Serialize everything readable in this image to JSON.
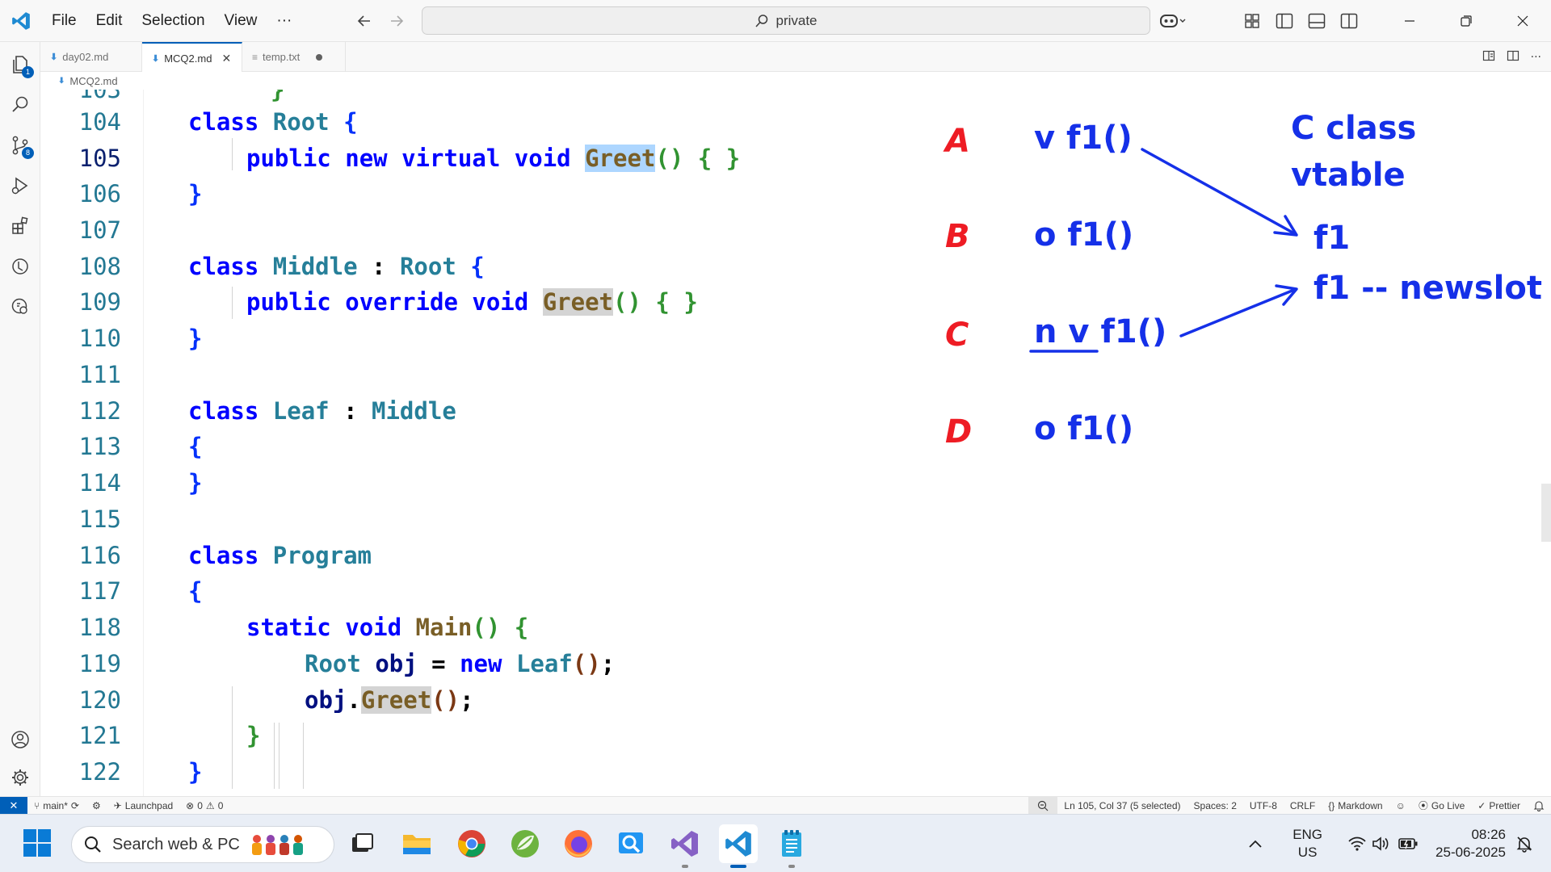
{
  "menu": [
    "File",
    "Edit",
    "Selection",
    "View",
    "···"
  ],
  "command_center": {
    "text": "private"
  },
  "tabs": [
    {
      "label": "day02.md"
    },
    {
      "label": "MCQ2.md",
      "close": "✕"
    },
    {
      "label": "temp.txt"
    }
  ],
  "activity": {
    "explorer_badge": "1",
    "scm_badge": "8"
  },
  "breadcrumb": {
    "file": "MCQ2.md"
  },
  "editor": {
    "partial_line_number": "103",
    "partial_line_text": "}",
    "lines": [
      {
        "n": "104"
      },
      {
        "n": "105"
      },
      {
        "n": "106"
      },
      {
        "n": "107"
      },
      {
        "n": "108"
      },
      {
        "n": "109"
      },
      {
        "n": "110"
      },
      {
        "n": "111"
      },
      {
        "n": "112"
      },
      {
        "n": "113"
      },
      {
        "n": "114"
      },
      {
        "n": "115"
      },
      {
        "n": "116"
      },
      {
        "n": "117"
      },
      {
        "n": "118"
      },
      {
        "n": "119"
      },
      {
        "n": "120"
      },
      {
        "n": "121"
      },
      {
        "n": "122"
      }
    ],
    "code": {
      "kw_class": "class",
      "kw_public": "public",
      "kw_new": "new",
      "kw_virtual": "virtual",
      "kw_void": "void",
      "kw_override": "override",
      "kw_static": "static",
      "type_root": "Root",
      "type_middle": "Middle",
      "type_leaf": "Leaf",
      "type_program": "Program",
      "fn_greet": "Greet",
      "fn_main": "Main",
      "var_obj": "obj",
      "colon": " : ",
      "lbrace": "{",
      "rbrace": "}",
      "parens": "()",
      "lparen": "(",
      "rparen": ")",
      "empty_body": "{ }",
      "assign": " = ",
      "semicolon": ";",
      "dot": "."
    }
  },
  "annotations": {
    "labels": [
      "A",
      "B",
      "C",
      "D"
    ],
    "row_a": "v f1()",
    "row_b": "o f1()",
    "row_c_n": "n",
    "row_c_v": "v",
    "row_c_fn": "f1()",
    "row_d": "o f1()",
    "vtable_title_1": "C class",
    "vtable_title_2": "vtable",
    "vtable_slot_1": "f1",
    "vtable_slot_2": "f1 -- newslot",
    "ink_red": "#ee1c24",
    "ink_blue": "#1530e8"
  },
  "statusbar": {
    "remote": "✕",
    "branch": "main*",
    "launchpad": "Launchpad",
    "problems": "0",
    "warnings": "0",
    "position": "Ln 105, Col 37 (5 selected)",
    "spaces": "Spaces: 2",
    "encoding": "UTF-8",
    "eol": "CRLF",
    "language": "Markdown",
    "golive": "Go Live",
    "prettier": "Prettier"
  },
  "taskbar": {
    "search_placeholder": "Search web & PC",
    "lang_1": "ENG",
    "lang_2": "US",
    "time": "08:26",
    "date": "25-06-2025"
  }
}
